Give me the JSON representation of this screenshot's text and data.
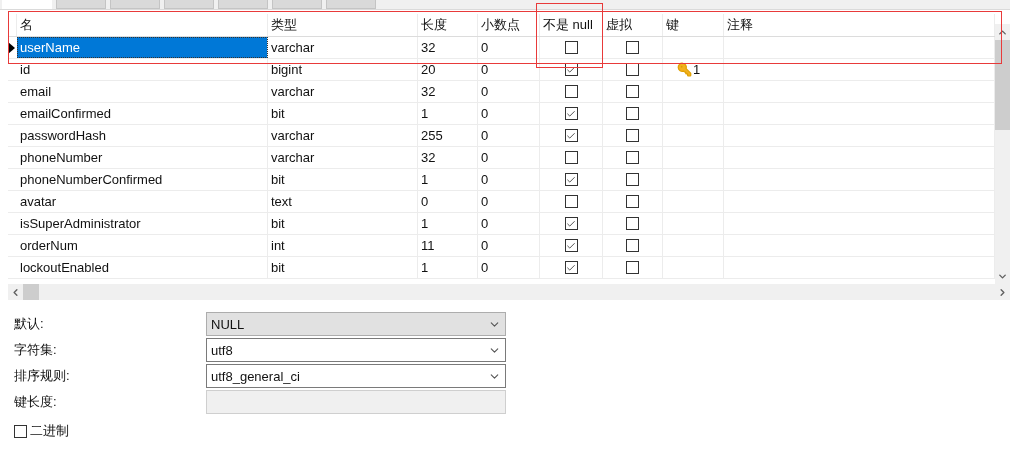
{
  "tabs": [
    {
      "selected": true
    },
    {
      "selected": false
    },
    {
      "selected": false
    },
    {
      "selected": false
    },
    {
      "selected": false
    },
    {
      "selected": false
    },
    {
      "selected": false
    }
  ],
  "table": {
    "columns": [
      "名",
      "类型",
      "长度",
      "小数点",
      "不是 null",
      "虚拟",
      "键",
      "注释"
    ],
    "rows": [
      {
        "name": "userName",
        "type": "varchar",
        "length": "32",
        "decimals": "0",
        "not_null": false,
        "virtual": false,
        "selected": true
      },
      {
        "name": "id",
        "type": "bigint",
        "length": "20",
        "decimals": "0",
        "not_null": true,
        "virtual": false,
        "selected": false,
        "key": "1"
      },
      {
        "name": "email",
        "type": "varchar",
        "length": "32",
        "decimals": "0",
        "not_null": false,
        "virtual": false,
        "selected": false
      },
      {
        "name": "emailConfirmed",
        "type": "bit",
        "length": "1",
        "decimals": "0",
        "not_null": true,
        "virtual": false,
        "selected": false
      },
      {
        "name": "passwordHash",
        "type": "varchar",
        "length": "255",
        "decimals": "0",
        "not_null": true,
        "virtual": false,
        "selected": false
      },
      {
        "name": "phoneNumber",
        "type": "varchar",
        "length": "32",
        "decimals": "0",
        "not_null": false,
        "virtual": false,
        "selected": false
      },
      {
        "name": "phoneNumberConfirmed",
        "type": "bit",
        "length": "1",
        "decimals": "0",
        "not_null": true,
        "virtual": false,
        "selected": false
      },
      {
        "name": "avatar",
        "type": "text",
        "length": "0",
        "decimals": "0",
        "not_null": false,
        "virtual": false,
        "selected": false
      },
      {
        "name": "isSuperAdministrator",
        "type": "bit",
        "length": "1",
        "decimals": "0",
        "not_null": true,
        "virtual": false,
        "selected": false
      },
      {
        "name": "orderNum",
        "type": "int",
        "length": "11",
        "decimals": "0",
        "not_null": true,
        "virtual": false,
        "selected": false
      },
      {
        "name": "lockoutEnabled",
        "type": "bit",
        "length": "1",
        "decimals": "0",
        "not_null": true,
        "virtual": false,
        "selected": false
      }
    ]
  },
  "properties": [
    {
      "label": "默认:",
      "kind": "dropdown",
      "value": "NULL",
      "disabled": true
    },
    {
      "label": "字符集:",
      "kind": "dropdown",
      "value": "utf8",
      "disabled": false
    },
    {
      "label": "排序规则:",
      "kind": "dropdown",
      "value": "utf8_general_ci",
      "disabled": false
    },
    {
      "label": "键长度:",
      "kind": "field",
      "disabled": true
    }
  ],
  "binary": {
    "label": "二进制",
    "checked": false
  }
}
